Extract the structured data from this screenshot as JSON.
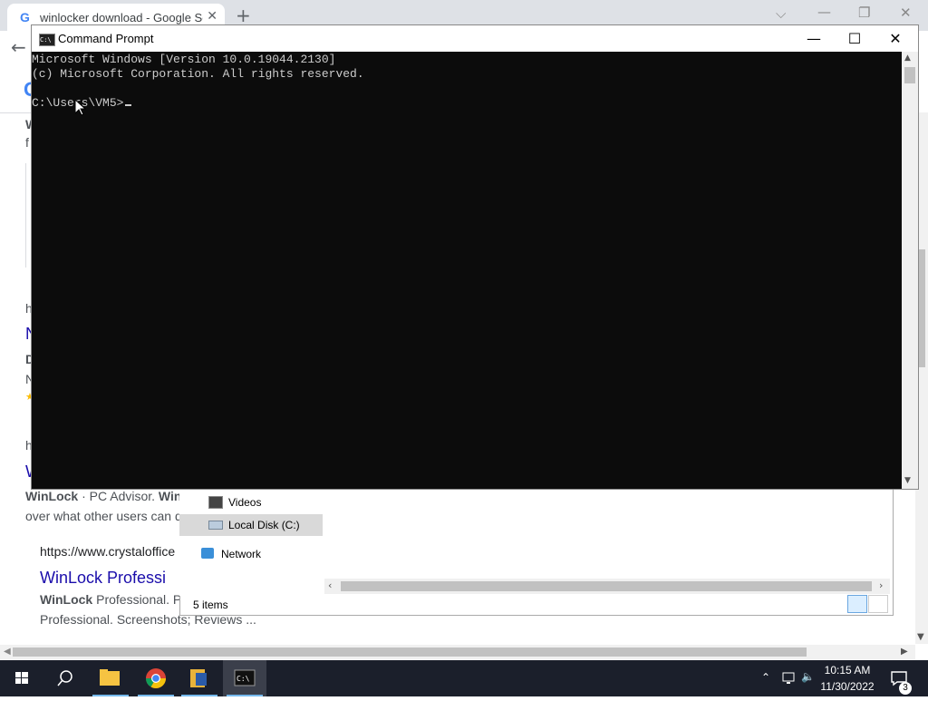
{
  "browser": {
    "tab_favicon": "G",
    "tab_title": "winlocker download - Google Se",
    "tab_close": "✕",
    "new_tab": "+",
    "window_controls": {
      "tab_search": "⌵",
      "minimize": "—",
      "restore": "❐",
      "close": "✕"
    },
    "back": "←",
    "google_g": "G",
    "results": {
      "frag_w": "W",
      "frag_f": "f",
      "frag_h1": "h",
      "frag_N_link": "N",
      "frag_D": "D",
      "frag_N2": "N",
      "frag_star": "★",
      "frag_h2": "h",
      "frag_W_link": "W",
      "winlock_line_parts": [
        "WinLock",
        " · PC Advisor. ",
        "WinL"
      ],
      "over_line": "over what other users can d",
      "url_line": "https://www.crystaloffice",
      "pro_link": "WinLock Professi",
      "pro_desc_parts": [
        "WinLock",
        " Professional. Pr"
      ],
      "pro_desc_line2": "Professional. Screenshots; Reviews ..."
    }
  },
  "explorer": {
    "nav_items": [
      {
        "label": "Videos",
        "icon": "video-folder-icon"
      },
      {
        "label": "Local Disk (C:)",
        "icon": "drive-icon",
        "selected": true
      },
      {
        "label": "Network",
        "icon": "network-icon"
      }
    ],
    "status": "5 items"
  },
  "cmd": {
    "title": "Command Prompt",
    "icon_text": "C:\\",
    "controls": {
      "minimize": "—",
      "maximize": "☐",
      "close": "✕"
    },
    "lines": [
      "Microsoft Windows [Version 10.0.19044.2130]",
      "(c) Microsoft Corporation. All rights reserved.",
      "",
      "C:\\Users\\VM5>"
    ]
  },
  "taskbar": {
    "clock_time": "10:15 AM",
    "clock_date": "11/30/2022",
    "notification_count": "3",
    "tray": {
      "chevron": "⌃",
      "volume": "🔈"
    }
  }
}
